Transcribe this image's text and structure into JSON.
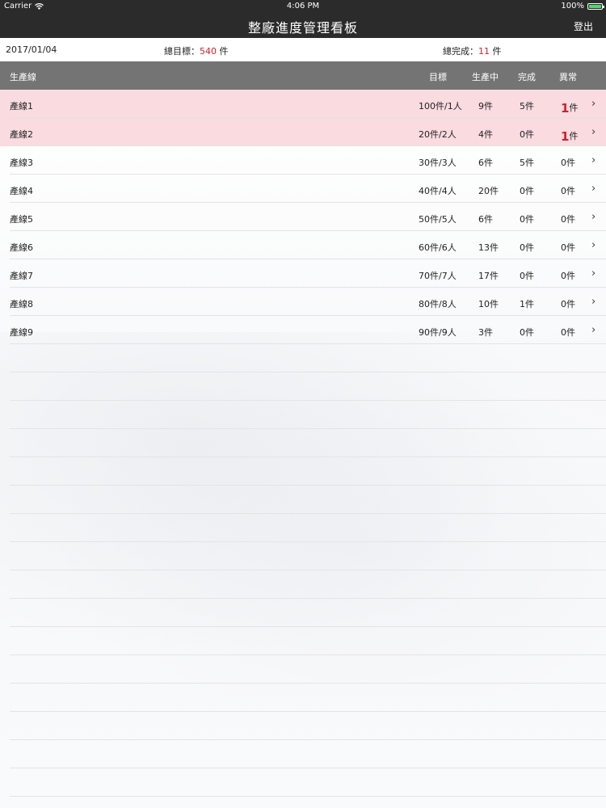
{
  "status_bar": {
    "carrier": "Carrier",
    "time": "4:06 PM",
    "battery": "100%"
  },
  "nav": {
    "title": "整廠進度管理看板",
    "logout_label": "登出"
  },
  "summary": {
    "date": "2017/01/04",
    "target_label": "總目標：",
    "target_value": "540",
    "target_unit": " 件",
    "done_label": "總完成：",
    "done_value": "11",
    "done_unit": " 件"
  },
  "table": {
    "headers": {
      "line": "生產線",
      "target": "目標",
      "in_production": "生產中",
      "done": "完成",
      "abnormal": "異常"
    },
    "rows": [
      {
        "name": "產線1",
        "target": "100件/1人",
        "in_production": "9件",
        "done": "5件",
        "abnormal_num": "1",
        "abnormal_unit": "件",
        "alert": true
      },
      {
        "name": "產線2",
        "target": "20件/2人",
        "in_production": "4件",
        "done": "0件",
        "abnormal_num": "1",
        "abnormal_unit": "件",
        "alert": true
      },
      {
        "name": "產線3",
        "target": "30件/3人",
        "in_production": "6件",
        "done": "5件",
        "abnormal_num": "0",
        "abnormal_unit": "件",
        "alert": false
      },
      {
        "name": "產線4",
        "target": "40件/4人",
        "in_production": "20件",
        "done": "0件",
        "abnormal_num": "0",
        "abnormal_unit": "件",
        "alert": false
      },
      {
        "name": "產線5",
        "target": "50件/5人",
        "in_production": "6件",
        "done": "0件",
        "abnormal_num": "0",
        "abnormal_unit": "件",
        "alert": false
      },
      {
        "name": "產線6",
        "target": "60件/6人",
        "in_production": "13件",
        "done": "0件",
        "abnormal_num": "0",
        "abnormal_unit": "件",
        "alert": false
      },
      {
        "name": "產線7",
        "target": "70件/7人",
        "in_production": "17件",
        "done": "0件",
        "abnormal_num": "0",
        "abnormal_unit": "件",
        "alert": false
      },
      {
        "name": "產線8",
        "target": "80件/8人",
        "in_production": "10件",
        "done": "1件",
        "abnormal_num": "0",
        "abnormal_unit": "件",
        "alert": false
      },
      {
        "name": "產線9",
        "target": "90件/9人",
        "in_production": "3件",
        "done": "0件",
        "abnormal_num": "0",
        "abnormal_unit": "件",
        "alert": false
      }
    ]
  },
  "colors": {
    "bar_bg": "#2b2b2b",
    "header_bg": "#747474",
    "alert_row_bg": "#f9dbe0",
    "alert_text": "#d0202a"
  }
}
